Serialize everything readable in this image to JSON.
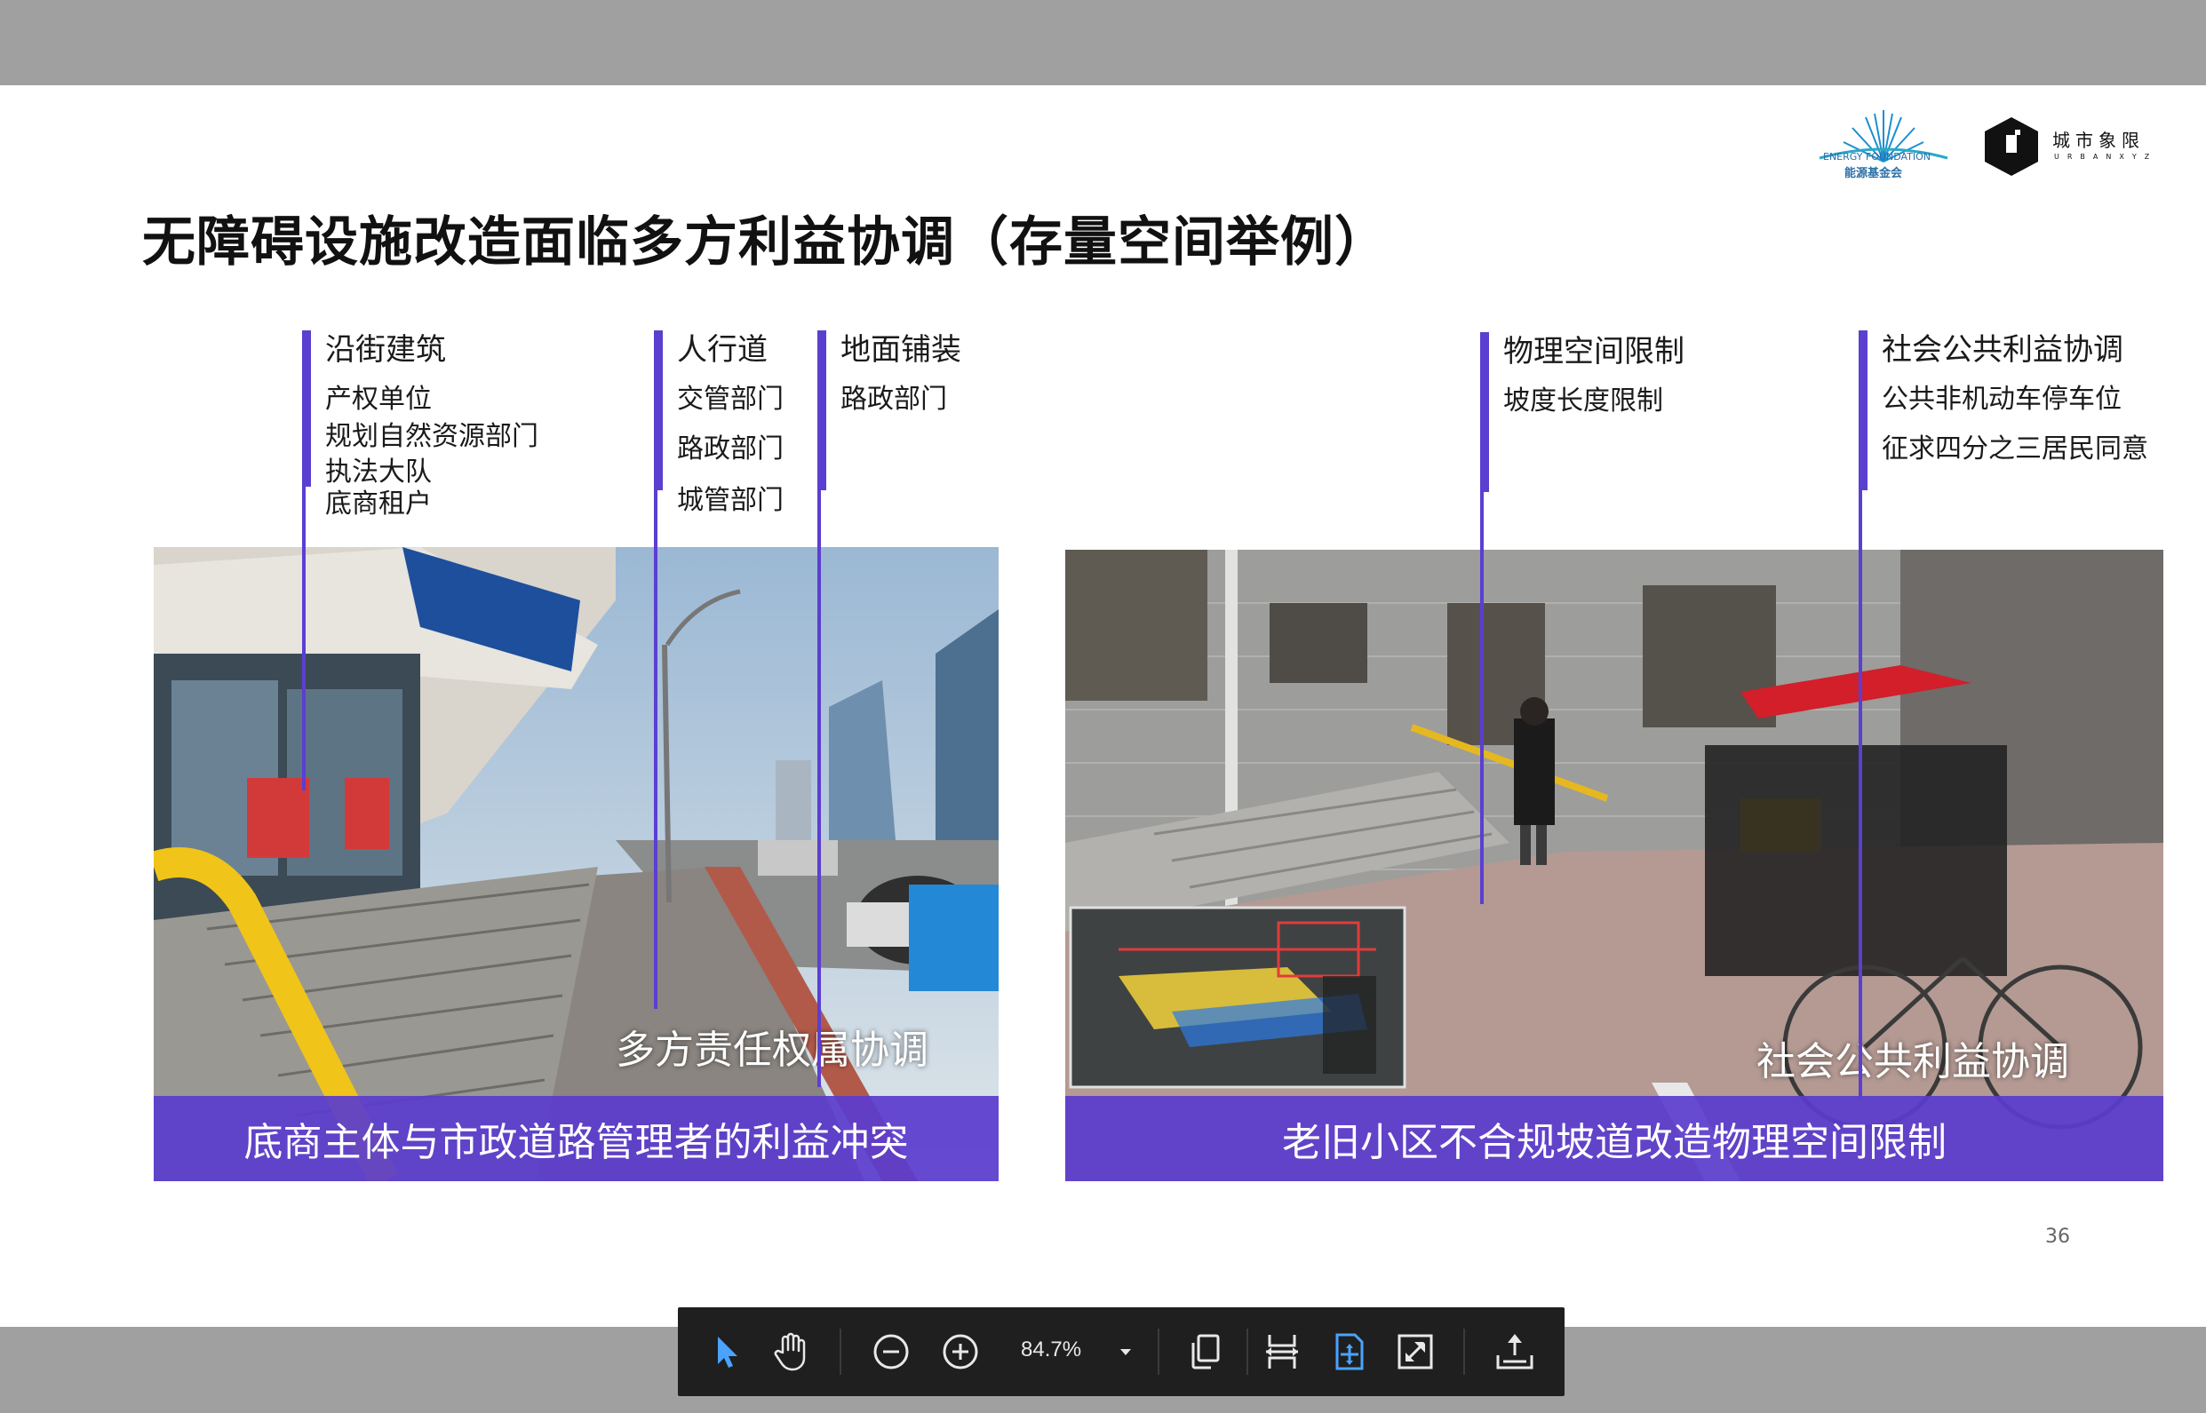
{
  "slide": {
    "title": "无障碍设施改造面临多方利益协调（存量空间举例）",
    "page_number": "36",
    "logos": {
      "energy_foundation_en": "ENERGY FOUNDATION",
      "energy_foundation_cn": "能源基金会",
      "urbanxyz_cn": "城市象限",
      "urbanxyz_en": "URBANXYZ"
    }
  },
  "annotations": {
    "street_building": {
      "title": "沿街建筑",
      "items": [
        "产权单位",
        "规划自然资源部门",
        "执法大队",
        "底商租户"
      ]
    },
    "sidewalk": {
      "title": "人行道",
      "items": [
        "交管部门",
        "路政部门",
        "城管部门"
      ]
    },
    "paving": {
      "title": "地面铺装",
      "items": [
        "路政部门"
      ]
    },
    "physical": {
      "title": "物理空间限制",
      "items": [
        "坡度长度限制"
      ]
    },
    "public": {
      "title": "社会公共利益协调",
      "items": [
        "公共非机动车停车位",
        "征求四分之三居民同意"
      ]
    }
  },
  "photos": {
    "left": {
      "overlay": "多方责任权属协调",
      "caption": "底商主体与市政道路管理者的利益冲突"
    },
    "right": {
      "overlay": "社会公共利益协调",
      "caption": "老旧小区不合规坡道改造物理空间限制"
    }
  },
  "toolbar": {
    "zoom": "84.7%",
    "tools": [
      "select-tool",
      "hand-tool",
      "zoom-out",
      "zoom-in",
      "zoom-menu",
      "page-view",
      "fit-width",
      "fit-page",
      "fullscreen",
      "export"
    ]
  },
  "colors": {
    "accent": "#5b3fd1",
    "toolbar_bg": "#1f1f1f",
    "active_icon": "#4aa3ff"
  }
}
